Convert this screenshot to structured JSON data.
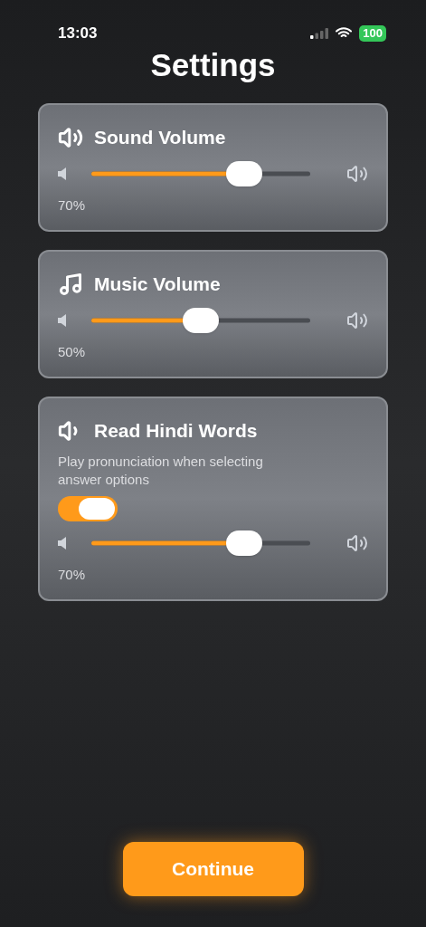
{
  "status_bar": {
    "time": "13:03",
    "battery": "100"
  },
  "title": "Settings",
  "cards": [
    {
      "kind": "slider",
      "title": "Sound Volume",
      "level": 0.7,
      "reading": "70%"
    },
    {
      "kind": "slider",
      "title": "Music Volume",
      "level": 0.5,
      "reading": "50%"
    },
    {
      "kind": "toggle_slider",
      "title": "Read Hindi Words",
      "description": "Play pronunciation when selecting answer options",
      "on": true,
      "level": 0.7,
      "reading": "70%"
    }
  ],
  "button": "Continue"
}
